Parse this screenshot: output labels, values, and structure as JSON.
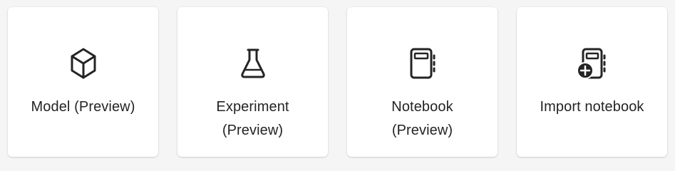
{
  "cards": [
    {
      "line1": "Model (Preview)",
      "line2": "",
      "icon": "cube-icon"
    },
    {
      "line1": "Experiment",
      "line2": "(Preview)",
      "icon": "flask-icon"
    },
    {
      "line1": "Notebook",
      "line2": "(Preview)",
      "icon": "notebook-icon"
    },
    {
      "line1": "Import notebook",
      "line2": "",
      "icon": "notebook-add-icon"
    }
  ],
  "colors": {
    "background": "#f5f5f5",
    "card": "#ffffff",
    "text": "#242424",
    "icon": "#242424"
  }
}
